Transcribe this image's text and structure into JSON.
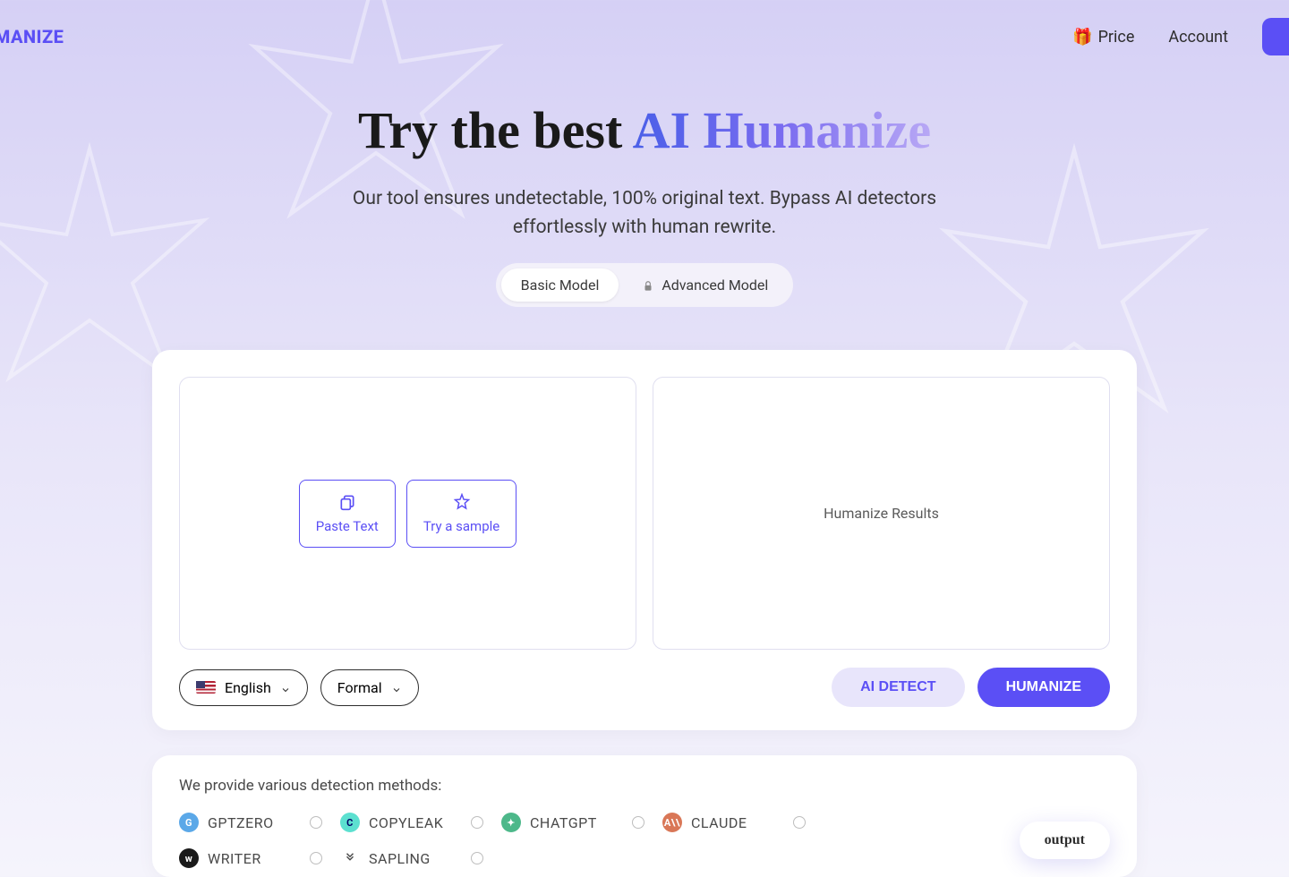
{
  "header": {
    "logo": "UMANIZE",
    "nav": {
      "price_emoji": "🎁",
      "price_label": "Price",
      "account_label": "Account"
    }
  },
  "hero": {
    "title_plain": "Try the best ",
    "title_gradient": "AI Humanize",
    "subtitle": "Our tool ensures undetectable, 100% original text. Bypass AI detectors effortlessly with human rewrite."
  },
  "models": {
    "basic": "Basic Model",
    "advanced": "Advanced Model"
  },
  "input_panel": {
    "paste_label": "Paste Text",
    "sample_label": "Try a sample"
  },
  "output_panel": {
    "placeholder": "Humanize Results"
  },
  "selects": {
    "language": "English",
    "tone": "Formal"
  },
  "actions": {
    "detect": "AI DETECT",
    "humanize": "HUMANIZE"
  },
  "detection": {
    "title": "We provide various detection methods:",
    "items": [
      {
        "name": "GPTZERO",
        "icon": "G",
        "class": "di-gptzero"
      },
      {
        "name": "COPYLEAK",
        "icon": "C",
        "class": "di-copyleak"
      },
      {
        "name": "CHATGPT",
        "icon": "✦",
        "class": "di-chatgpt"
      },
      {
        "name": "CLAUDE",
        "icon": "A\\\\",
        "class": "di-claude"
      },
      {
        "name": "WRITER",
        "icon": "w",
        "class": "di-writer"
      },
      {
        "name": "SAPLING",
        "icon": "",
        "class": "di-sapling"
      }
    ],
    "pill": "output"
  }
}
